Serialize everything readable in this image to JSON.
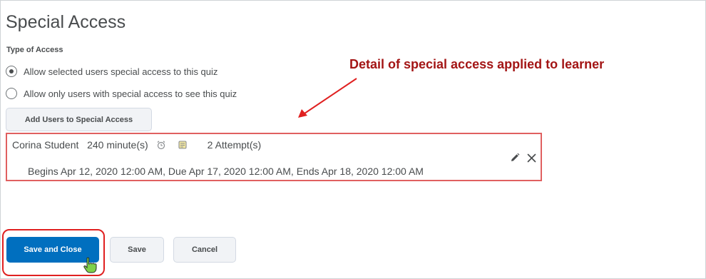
{
  "page": {
    "title": "Special Access"
  },
  "type_of_access": {
    "label": "Type of Access",
    "options": [
      {
        "label": "Allow selected users special access to this quiz",
        "selected": true
      },
      {
        "label": "Allow only users with special access to see this quiz",
        "selected": false
      }
    ]
  },
  "add_users_button": {
    "label": "Add Users to Special Access"
  },
  "special_access_entry": {
    "name": "Corina Student",
    "time_limit": "240 minute(s)",
    "attempts": "2 Attempt(s)",
    "dates": "Begins Apr 12, 2020 12:00 AM, Due Apr 17, 2020 12:00 AM, Ends Apr 18, 2020 12:00 AM",
    "icons": [
      "alarm-clock-icon",
      "timer-icon",
      "edit-pencil-icon",
      "remove-x-icon"
    ]
  },
  "annotation": {
    "text": "Detail of special access applied to learner",
    "color": "#a31515"
  },
  "footer": {
    "save_close_label": "Save and Close",
    "save_label": "Save",
    "cancel_label": "Cancel"
  },
  "colors": {
    "primary": "#006fbf",
    "text": "#494c4e",
    "highlight_border": "#e02020",
    "entry_border": "#e06060"
  }
}
